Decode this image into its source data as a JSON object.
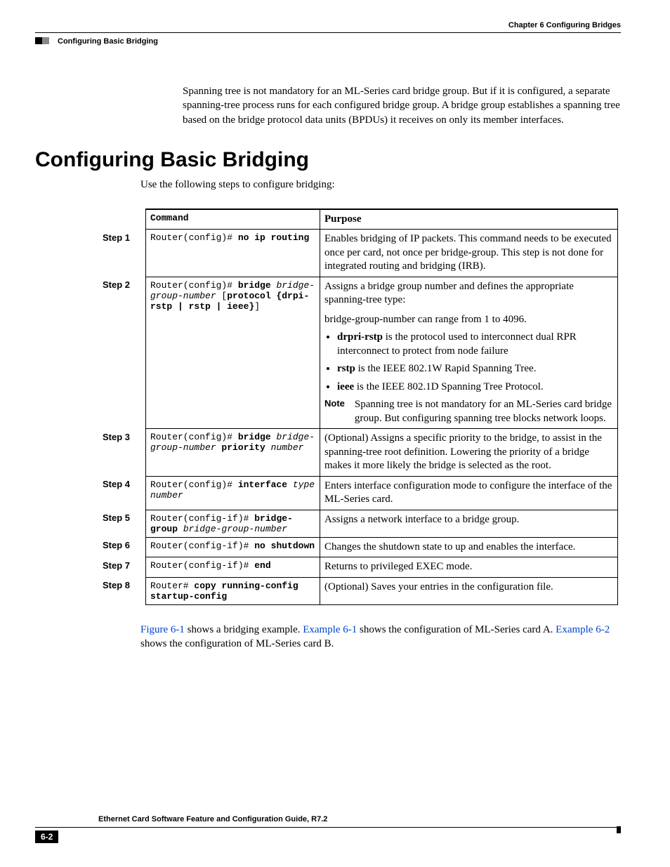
{
  "header": {
    "chapter": "Chapter 6  Configuring Bridges",
    "section": "Configuring Basic Bridging"
  },
  "intro": "Spanning tree is not mandatory for an ML-Series card bridge group. But if it is configured, a separate spanning-tree process runs for each configured bridge group. A bridge group establishes a spanning tree based on the bridge protocol data units (BPDUs) it receives on only its member interfaces.",
  "heading": "Configuring Basic Bridging",
  "lead": "Use the following steps to configure bridging:",
  "table": {
    "headers": {
      "step": "",
      "command": "Command",
      "purpose": "Purpose"
    },
    "rows": [
      {
        "step": "Step 1",
        "cmd_prefix": "Router(config)# ",
        "cmd_bold": "no ip routing",
        "cmd_suffix": "",
        "purpose": "Enables bridging of IP packets. This command needs to be executed once per card, not once per bridge-group. This step is not done for integrated routing and bridging (IRB)."
      },
      {
        "step": "Step 2",
        "cmd_prefix": "Router(config)# ",
        "cmd_bold": "bridge",
        "cmd_italic2": " bridge-group-number",
        "cmd_plain3": " [",
        "cmd_bold4": "protocol {drpi-rstp | rstp | ieee}",
        "cmd_plain5": "]",
        "purpose_intro": "Assigns a bridge group number and defines the appropriate spanning-tree type:",
        "purpose_line2": "bridge-group-number can range from 1 to 4096.",
        "bullets": [
          {
            "b": "drpri-rstp",
            "t": " is the protocol used to interconnect dual RPR interconnect to protect from node failure"
          },
          {
            "b": "rstp",
            "t": " is the IEEE 802.1W Rapid Spanning Tree."
          },
          {
            "b": "ieee",
            "t": " is the IEEE 802.1D Spanning Tree Protocol."
          }
        ],
        "note_label": "Note",
        "note_text": "Spanning tree is not mandatory for an ML-Series card bridge group. But configuring spanning tree blocks network loops."
      },
      {
        "step": "Step 3",
        "cmd_prefix": "Router(config)# ",
        "cmd_bold": "bridge",
        "cmd_italic2": " bridge-group-number",
        "cmd_bold3": " priority",
        "cmd_italic4": " number",
        "purpose": "(Optional) Assigns a specific priority to the bridge, to assist in the spanning-tree root definition. Lowering the priority of a bridge makes it more likely the bridge is selected as the root."
      },
      {
        "step": "Step 4",
        "cmd_prefix": "Router(config)# ",
        "cmd_bold": "interface",
        "cmd_italic2": " type number",
        "purpose": "Enters interface configuration mode to configure the interface of the ML-Series card."
      },
      {
        "step": "Step 5",
        "cmd_prefix": "Router(config-if)# ",
        "cmd_bold": "bridge-group",
        "cmd_italic2": " bridge-group-number",
        "purpose": "Assigns a network interface to a bridge group."
      },
      {
        "step": "Step 6",
        "cmd_prefix": "Router(config-if)# ",
        "cmd_bold": "no shutdown",
        "purpose": "Changes the shutdown state to up and enables the interface."
      },
      {
        "step": "Step 7",
        "cmd_prefix": "Router(config-if)# ",
        "cmd_bold": "end",
        "purpose": "Returns to privileged EXEC mode."
      },
      {
        "step": "Step 8",
        "cmd_prefix": "Router# ",
        "cmd_bold": "copy running-config startup-config",
        "purpose": "(Optional) Saves your entries in the configuration file."
      }
    ]
  },
  "after": {
    "link1": "Figure 6-1",
    "t1": " shows a bridging example. ",
    "link2": "Example 6-1",
    "t2": " shows the configuration of ML-Series card A. ",
    "link3": "Example 6-2",
    "t3": " shows the configuration of ML-Series card B."
  },
  "footer": {
    "title": "Ethernet Card Software Feature and Configuration Guide, R7.2",
    "page": "6-2"
  }
}
